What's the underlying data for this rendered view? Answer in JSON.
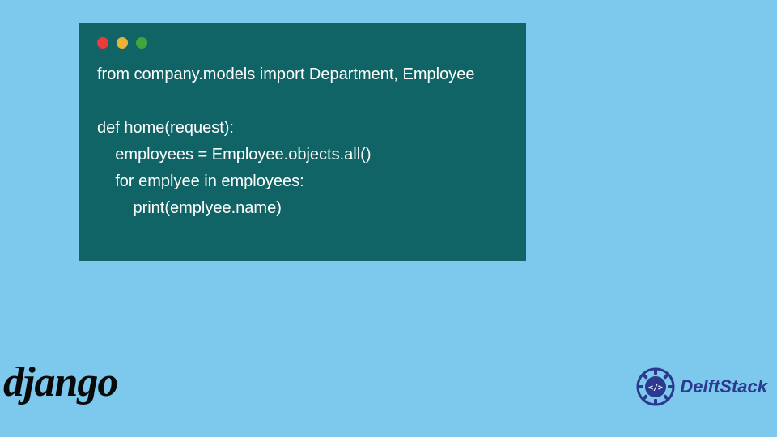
{
  "code": {
    "line1": "from company.models import Department, Employee",
    "line2": "",
    "line3": "def home(request):",
    "line4": "    employees = Employee.objects.all()",
    "line5": "    for emplyee in employees:",
    "line6": "        print(emplyee.name)"
  },
  "traffic_colors": {
    "red": "#ed3b3b",
    "yellow": "#e8b339",
    "green": "#3fa73f"
  },
  "branding": {
    "django": "django",
    "delft": "DelftStack"
  },
  "palette": {
    "background": "#7cc9ed",
    "code_bg": "#116466",
    "code_fg": "#ffffff",
    "delft_blue": "#2b3a8f"
  }
}
